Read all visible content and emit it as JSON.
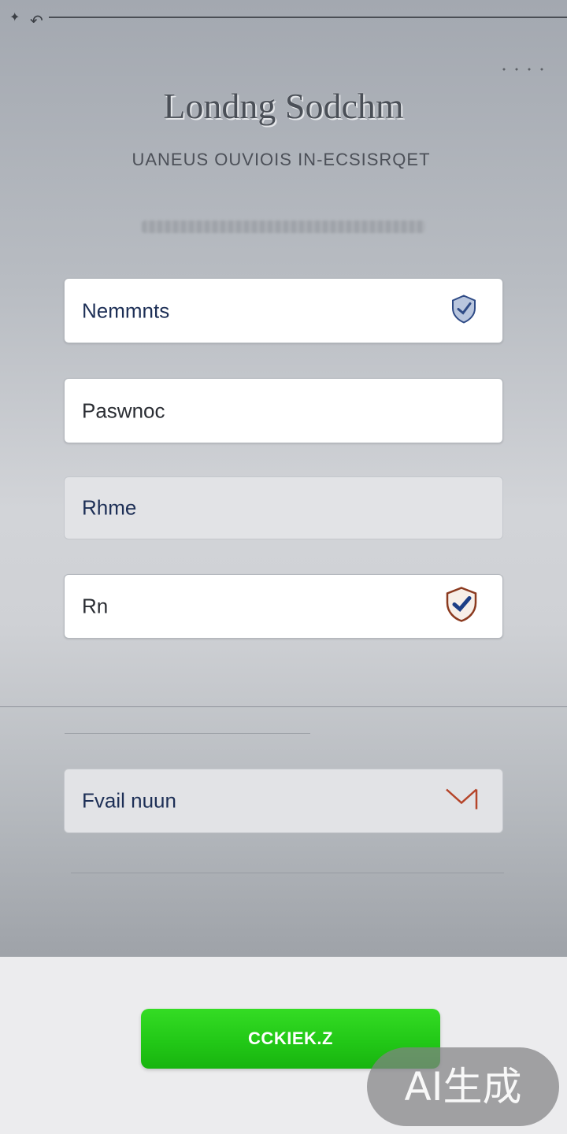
{
  "header": {
    "title": "Londng Sodchm",
    "subtitle": "UANEUS OUVIOIS IN-ECSISRQET"
  },
  "fields": [
    {
      "label": "Nemmnts",
      "icon": "shield-icon"
    },
    {
      "label": "Paswnoc"
    },
    {
      "label": "Rhme"
    },
    {
      "label": "Rn",
      "icon": "shield-check-icon"
    }
  ],
  "email_field": {
    "label": "Fvail nuun",
    "icon": "mail-icon"
  },
  "submit": {
    "label": "CCKIEK.Z"
  },
  "watermark": {
    "text": "AI生成"
  },
  "colors": {
    "accent": "#22c817",
    "field_text": "#1d2f56",
    "shield_border": "#8b3a1f",
    "mail_icon": "#b5452a"
  }
}
